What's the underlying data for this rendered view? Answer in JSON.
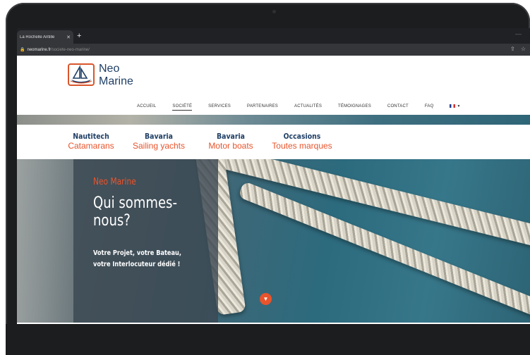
{
  "browser": {
    "tab_title": "La Rochelle Antille",
    "tab_close": "✕",
    "new_tab": "+",
    "url_host": "neomarine.fr",
    "url_path": "/societe-neo-marine/",
    "lock_icon": "🔒",
    "share_icon": "⇪",
    "star_icon": "☆"
  },
  "site": {
    "logo_line1": "Neo",
    "logo_line2": "Marine",
    "nav": [
      {
        "label": "ACCUEIL",
        "active": false
      },
      {
        "label": "SOCIÉTÉ",
        "active": true
      },
      {
        "label": "SERVICES",
        "active": false
      },
      {
        "label": "PARTENAIRES",
        "active": false
      },
      {
        "label": "ACTUALITÉS",
        "active": false
      },
      {
        "label": "TÉMOIGNAGES",
        "active": false
      },
      {
        "label": "CONTACT",
        "active": false
      },
      {
        "label": "FAQ",
        "active": false
      }
    ],
    "language": "fr"
  },
  "categories": [
    {
      "brand": "Nautitech",
      "sub": "Catamarans"
    },
    {
      "brand": "Bavaria",
      "sub": "Sailing yachts"
    },
    {
      "brand": "Bavaria",
      "sub": "Motor boats"
    },
    {
      "brand": "Occasions",
      "sub": "Toutes marques"
    }
  ],
  "hero": {
    "kicker": "Neo Marine",
    "title": "Qui sommes-nous?",
    "subtitle": "Votre Projet, votre Bateau, votre Interlocuteur dédié !",
    "scroll_icon": "▼"
  },
  "colors": {
    "brand_navy": "#1f3f66",
    "accent_orange": "#e8542c"
  }
}
